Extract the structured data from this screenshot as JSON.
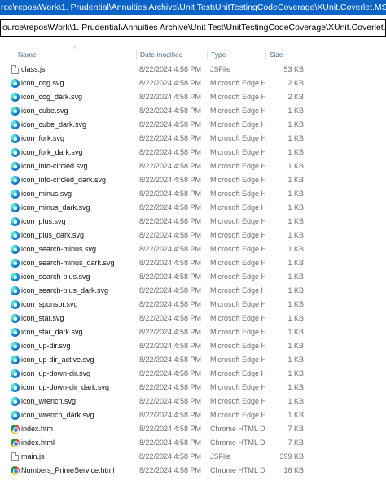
{
  "top_path": "rce\\repos\\Work\\1. Prudential\\Annuities Archive\\Unit Test\\UnitTestingCodeCoverage\\XUnit.Coverlet.MSBuild\\coveragereport",
  "address_bar": "ource\\repos\\Work\\1. Prudential\\Annuities Archive\\Unit Test\\UnitTestingCodeCoverage\\XUnit.Coverlet.MSBuild\\coveragereport",
  "columns": {
    "name": "Name",
    "date": "Date modified",
    "type": "Type",
    "size": "Size",
    "sort_indicator": "^"
  },
  "files": [
    {
      "name": "class.js",
      "date": "8/22/2024 4:58 PM",
      "type": "JSFile",
      "size": "53 KB",
      "icon": "document-icon"
    },
    {
      "name": "icon_cog.svg",
      "date": "8/22/2024 4:58 PM",
      "type": "Microsoft Edge H...",
      "size": "2 KB",
      "icon": "edge-icon"
    },
    {
      "name": "icon_cog_dark.svg",
      "date": "8/22/2024 4:58 PM",
      "type": "Microsoft Edge H...",
      "size": "2 KB",
      "icon": "edge-icon"
    },
    {
      "name": "icon_cube.svg",
      "date": "8/22/2024 4:58 PM",
      "type": "Microsoft Edge H...",
      "size": "1 KB",
      "icon": "edge-icon"
    },
    {
      "name": "icon_cube_dark.svg",
      "date": "8/22/2024 4:58 PM",
      "type": "Microsoft Edge H...",
      "size": "1 KB",
      "icon": "edge-icon"
    },
    {
      "name": "icon_fork.svg",
      "date": "8/22/2024 4:58 PM",
      "type": "Microsoft Edge H...",
      "size": "1 KB",
      "icon": "edge-icon"
    },
    {
      "name": "icon_fork_dark.svg",
      "date": "8/22/2024 4:58 PM",
      "type": "Microsoft Edge H...",
      "size": "1 KB",
      "icon": "edge-icon"
    },
    {
      "name": "icon_info-circled.svg",
      "date": "8/22/2024 4:58 PM",
      "type": "Microsoft Edge H...",
      "size": "1 KB",
      "icon": "edge-icon"
    },
    {
      "name": "icon_info-circled_dark.svg",
      "date": "8/22/2024 4:58 PM",
      "type": "Microsoft Edge H...",
      "size": "1 KB",
      "icon": "edge-icon"
    },
    {
      "name": "icon_minus.svg",
      "date": "8/22/2024 4:58 PM",
      "type": "Microsoft Edge H...",
      "size": "1 KB",
      "icon": "edge-icon"
    },
    {
      "name": "icon_minus_dark.svg",
      "date": "8/22/2024 4:58 PM",
      "type": "Microsoft Edge H...",
      "size": "1 KB",
      "icon": "edge-icon"
    },
    {
      "name": "icon_plus.svg",
      "date": "8/22/2024 4:58 PM",
      "type": "Microsoft Edge H...",
      "size": "1 KB",
      "icon": "edge-icon"
    },
    {
      "name": "icon_plus_dark.svg",
      "date": "8/22/2024 4:58 PM",
      "type": "Microsoft Edge H...",
      "size": "1 KB",
      "icon": "edge-icon"
    },
    {
      "name": "icon_search-minus.svg",
      "date": "8/22/2024 4:58 PM",
      "type": "Microsoft Edge H...",
      "size": "1 KB",
      "icon": "edge-icon"
    },
    {
      "name": "icon_search-minus_dark.svg",
      "date": "8/22/2024 4:58 PM",
      "type": "Microsoft Edge H...",
      "size": "1 KB",
      "icon": "edge-icon"
    },
    {
      "name": "icon_search-plus.svg",
      "date": "8/22/2024 4:58 PM",
      "type": "Microsoft Edge H...",
      "size": "1 KB",
      "icon": "edge-icon"
    },
    {
      "name": "icon_search-plus_dark.svg",
      "date": "8/22/2024 4:58 PM",
      "type": "Microsoft Edge H...",
      "size": "1 KB",
      "icon": "edge-icon"
    },
    {
      "name": "icon_sponsor.svg",
      "date": "8/22/2024 4:58 PM",
      "type": "Microsoft Edge H...",
      "size": "1 KB",
      "icon": "edge-icon"
    },
    {
      "name": "icon_star.svg",
      "date": "8/22/2024 4:58 PM",
      "type": "Microsoft Edge H...",
      "size": "1 KB",
      "icon": "edge-icon"
    },
    {
      "name": "icon_star_dark.svg",
      "date": "8/22/2024 4:58 PM",
      "type": "Microsoft Edge H...",
      "size": "1 KB",
      "icon": "edge-icon"
    },
    {
      "name": "icon_up-dir.svg",
      "date": "8/22/2024 4:58 PM",
      "type": "Microsoft Edge H...",
      "size": "1 KB",
      "icon": "edge-icon"
    },
    {
      "name": "icon_up-dir_active.svg",
      "date": "8/22/2024 4:58 PM",
      "type": "Microsoft Edge H...",
      "size": "1 KB",
      "icon": "edge-icon"
    },
    {
      "name": "icon_up-down-dir.svg",
      "date": "8/22/2024 4:58 PM",
      "type": "Microsoft Edge H...",
      "size": "1 KB",
      "icon": "edge-icon"
    },
    {
      "name": "icon_up-down-dir_dark.svg",
      "date": "8/22/2024 4:58 PM",
      "type": "Microsoft Edge H...",
      "size": "1 KB",
      "icon": "edge-icon"
    },
    {
      "name": "icon_wrench.svg",
      "date": "8/22/2024 4:58 PM",
      "type": "Microsoft Edge H...",
      "size": "1 KB",
      "icon": "edge-icon"
    },
    {
      "name": "icon_wrench_dark.svg",
      "date": "8/22/2024 4:58 PM",
      "type": "Microsoft Edge H...",
      "size": "1 KB",
      "icon": "edge-icon"
    },
    {
      "name": "index.htm",
      "date": "8/22/2024 4:58 PM",
      "type": "Chrome HTML Do...",
      "size": "7 KB",
      "icon": "chrome-icon"
    },
    {
      "name": "index.html",
      "date": "8/22/2024 4:58 PM",
      "type": "Chrome HTML Do...",
      "size": "7 KB",
      "icon": "chrome-icon"
    },
    {
      "name": "main.js",
      "date": "8/22/2024 4:58 PM",
      "type": "JSFile",
      "size": "399 KB",
      "icon": "document-icon"
    },
    {
      "name": "Numbers_PrimeService.html",
      "date": "8/22/2024 4:58 PM",
      "type": "Chrome HTML Do...",
      "size": "16 KB",
      "icon": "chrome-icon"
    }
  ],
  "colors": {
    "path_highlight": "#0a64c8",
    "secondary_text": "#6d6d6d",
    "header_text": "#4a6a8a"
  }
}
